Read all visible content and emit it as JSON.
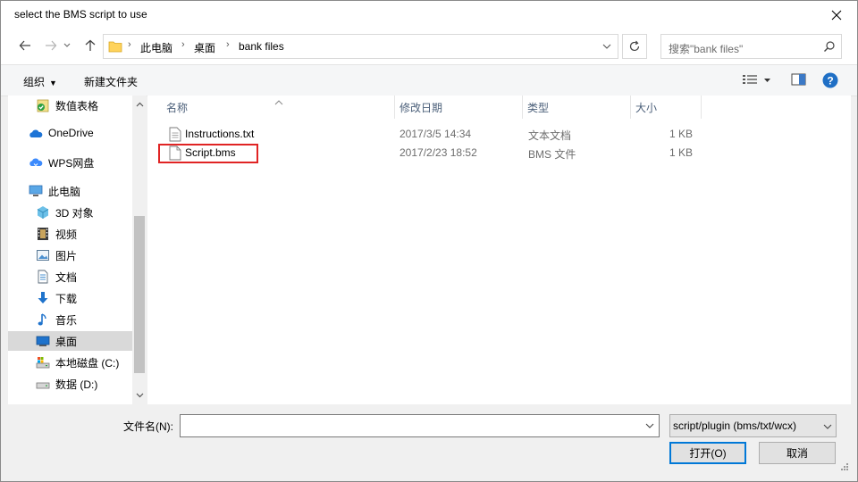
{
  "window": {
    "title": "select the BMS script to use"
  },
  "address": {
    "crumbs": [
      "此电脑",
      "桌面",
      "bank files"
    ]
  },
  "search": {
    "placeholder": "搜索\"bank files\""
  },
  "toolbar": {
    "organize_label": "组织",
    "new_folder_label": "新建文件夹"
  },
  "sidebar": {
    "items": [
      {
        "label": "数值表格",
        "icon": "spreadsheet-check-icon"
      },
      {
        "label": "OneDrive",
        "icon": "onedrive-cloud-icon"
      },
      {
        "label": "WPS网盘",
        "icon": "wps-cloud-icon"
      },
      {
        "label": "此电脑",
        "icon": "computer-icon"
      },
      {
        "label": "3D 对象",
        "icon": "cube-3d-icon"
      },
      {
        "label": "视频",
        "icon": "video-icon"
      },
      {
        "label": "图片",
        "icon": "picture-icon"
      },
      {
        "label": "文档",
        "icon": "document-icon"
      },
      {
        "label": "下载",
        "icon": "download-arrow-icon"
      },
      {
        "label": "音乐",
        "icon": "music-note-icon"
      },
      {
        "label": "桌面",
        "icon": "desktop-icon",
        "selected": true
      },
      {
        "label": "本地磁盘 (C:)",
        "icon": "system-drive-icon"
      },
      {
        "label": "数据 (D:)",
        "icon": "drive-icon"
      }
    ]
  },
  "columns": {
    "name": "名称",
    "date": "修改日期",
    "type": "类型",
    "size": "大小"
  },
  "files": [
    {
      "name": "Instructions.txt",
      "date": "2017/3/5 14:34",
      "type": "文本文档",
      "size": "1 KB",
      "icon": "text-file-icon"
    },
    {
      "name": "Script.bms",
      "date": "2017/2/23 18:52",
      "type": "BMS 文件",
      "size": "1 KB",
      "icon": "blank-file-icon",
      "highlighted": true
    }
  ],
  "footer": {
    "filename_label": "文件名(N):",
    "filename_value": "",
    "filter_value": "script/plugin (bms/txt/wcx)",
    "open_label": "打开(O)",
    "cancel_label": "取消"
  },
  "colors": {
    "accent": "#0078d7",
    "highlight_box": "#e02424",
    "selected_bg": "#d9d9d9",
    "help_icon": "#1f6fc5"
  }
}
